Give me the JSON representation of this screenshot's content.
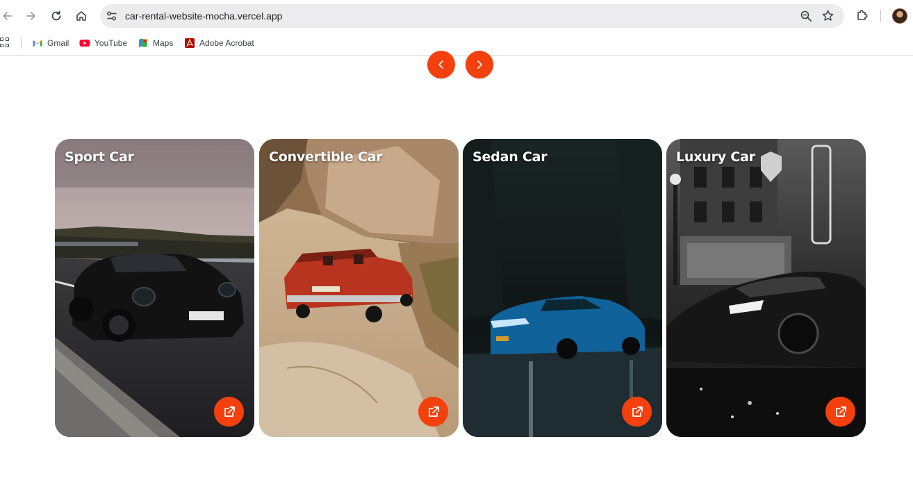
{
  "browser": {
    "url": "car-rental-website-mocha.vercel.app",
    "bookmarks": [
      {
        "label": "Gmail",
        "icon": "gmail-icon"
      },
      {
        "label": "YouTube",
        "icon": "youtube-icon"
      },
      {
        "label": "Maps",
        "icon": "maps-icon"
      },
      {
        "label": "Adobe Acrobat",
        "icon": "adobe-acrobat-icon"
      }
    ]
  },
  "carousel": {
    "prev_icon": "chevron-left-icon",
    "next_icon": "chevron-right-icon",
    "accent_color": "#f4400d"
  },
  "cards": [
    {
      "title": "Sport Car",
      "image": "black sports coupe on roadside at sunset",
      "action_icon": "external-link-icon"
    },
    {
      "title": "Convertible Car",
      "image": "red vintage convertible on desert dirt road",
      "action_icon": "external-link-icon"
    },
    {
      "title": "Sedan Car",
      "image": "blue sedan in dark forest on wet road",
      "action_icon": "external-link-icon"
    },
    {
      "title": "Luxury Car",
      "image": "black luxury coupe on city street at night",
      "action_icon": "external-link-icon"
    }
  ]
}
